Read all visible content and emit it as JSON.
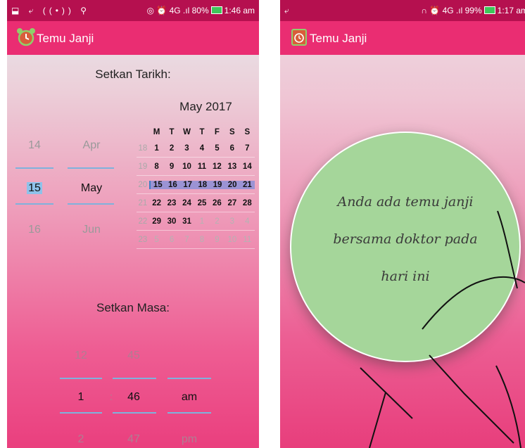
{
  "left": {
    "status": {
      "icons_left": "⬓ ⤶ ((•)) ⚲",
      "icons_right": "◎ ⏰ 4G .ıl",
      "battery": "80%",
      "time": "1:46 am"
    },
    "appbar": {
      "title": "Temu Janji"
    },
    "date_heading": "Setkan Tarikh:",
    "day_picker": {
      "prev": "14",
      "current": "15",
      "next": "16"
    },
    "month_picker": {
      "prev": "Apr",
      "current": "May",
      "next": "Jun"
    },
    "calendar": {
      "title": "May 2017",
      "weekdays": [
        "M",
        "T",
        "W",
        "T",
        "F",
        "S",
        "S"
      ],
      "weeks": [
        {
          "no": "18",
          "days": [
            "1",
            "2",
            "3",
            "4",
            "5",
            "6",
            "7"
          ]
        },
        {
          "no": "19",
          "days": [
            "8",
            "9",
            "10",
            "11",
            "12",
            "13",
            "14"
          ]
        },
        {
          "no": "20",
          "days": [
            "15",
            "16",
            "17",
            "18",
            "19",
            "20",
            "21"
          ]
        },
        {
          "no": "21",
          "days": [
            "22",
            "23",
            "24",
            "25",
            "26",
            "27",
            "28"
          ]
        },
        {
          "no": "22",
          "days": [
            "29",
            "30",
            "31",
            "1",
            "2",
            "3",
            "4"
          ]
        },
        {
          "no": "23",
          "days": [
            "5",
            "6",
            "7",
            "8",
            "9",
            "10",
            "11"
          ]
        }
      ]
    },
    "time_heading": "Setkan Masa:",
    "hour_picker": {
      "prev": "12",
      "current": "1",
      "next": "2"
    },
    "minute_picker": {
      "prev": "45",
      "current": "46",
      "next": "47"
    },
    "ampm_picker": {
      "current": "am",
      "next": "pm"
    },
    "separator": ":"
  },
  "right": {
    "status": {
      "icons_left": "⤶",
      "icons_right": "∩ ⏰ 4G .ıl",
      "battery": "99%",
      "time": "1:17 am"
    },
    "appbar": {
      "title": "Temu Janji"
    },
    "message_lines": [
      "Anda ada temu janji",
      "bersama doktor pada",
      "hari ini"
    ]
  },
  "colors": {
    "status_bar": "#b5104f",
    "app_bar": "#ea2d72",
    "circle": "#a5d69a",
    "week_highlight": "#9b93d4"
  }
}
